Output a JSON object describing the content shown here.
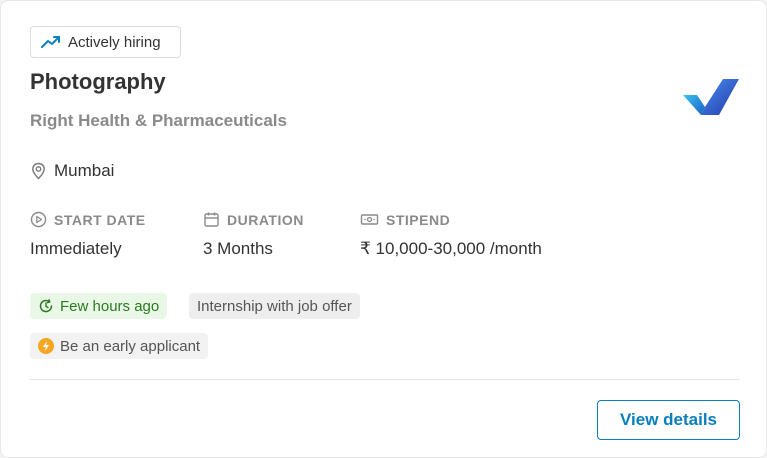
{
  "badge": {
    "label": "Actively hiring",
    "icon": "trending-up-icon"
  },
  "job": {
    "title": "Photography",
    "company": "Right Health & Pharmaceuticals",
    "location": "Mumbai"
  },
  "meta": [
    {
      "heading": "START DATE",
      "value": "Immediately",
      "icon": "play-circle-icon"
    },
    {
      "heading": "DURATION",
      "value": "3 Months",
      "icon": "calendar-icon"
    },
    {
      "heading": "STIPEND",
      "value": "₹ 10,000-30,000 /month",
      "icon": "money-icon"
    }
  ],
  "tags": {
    "posted": "Few hours ago",
    "job_offer": "Internship with job offer",
    "early": "Be an early applicant"
  },
  "actions": {
    "view_details": "View details"
  },
  "colors": {
    "accent": "#0a7fbf",
    "posted_bg": "#e9f8e6",
    "posted_text": "#2d7a1f",
    "early_icon": "#f5a623"
  }
}
